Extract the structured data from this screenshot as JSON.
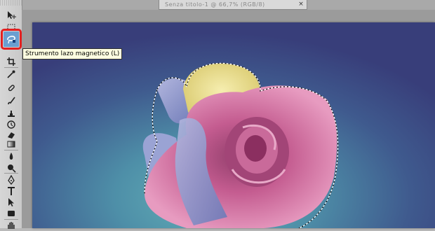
{
  "document": {
    "tab_title": "Senza titolo-1 @ 66,7% (RGB/8)",
    "close_glyph": "×"
  },
  "toolbar": {
    "active_tool": "magnetic-lasso",
    "tools": [
      "move-icon",
      "marquee-icon",
      "magnetic-lasso-icon",
      "quick-selection-icon",
      "crop-icon",
      "eyedropper-icon",
      "healing-brush-icon",
      "brush-icon",
      "clone-stamp-icon",
      "history-brush-icon",
      "eraser-icon",
      "gradient-icon",
      "blur-icon",
      "dodge-icon",
      "pen-icon",
      "type-icon",
      "path-selection-icon",
      "rectangle-icon",
      "hand-icon"
    ]
  },
  "tooltip": {
    "text": "Strumento lazo magnetico (L)"
  },
  "colors": {
    "highlight": "#e32020",
    "active_tool_bg": "#6b9fd0",
    "tooltip_bg": "#ffffe1"
  }
}
